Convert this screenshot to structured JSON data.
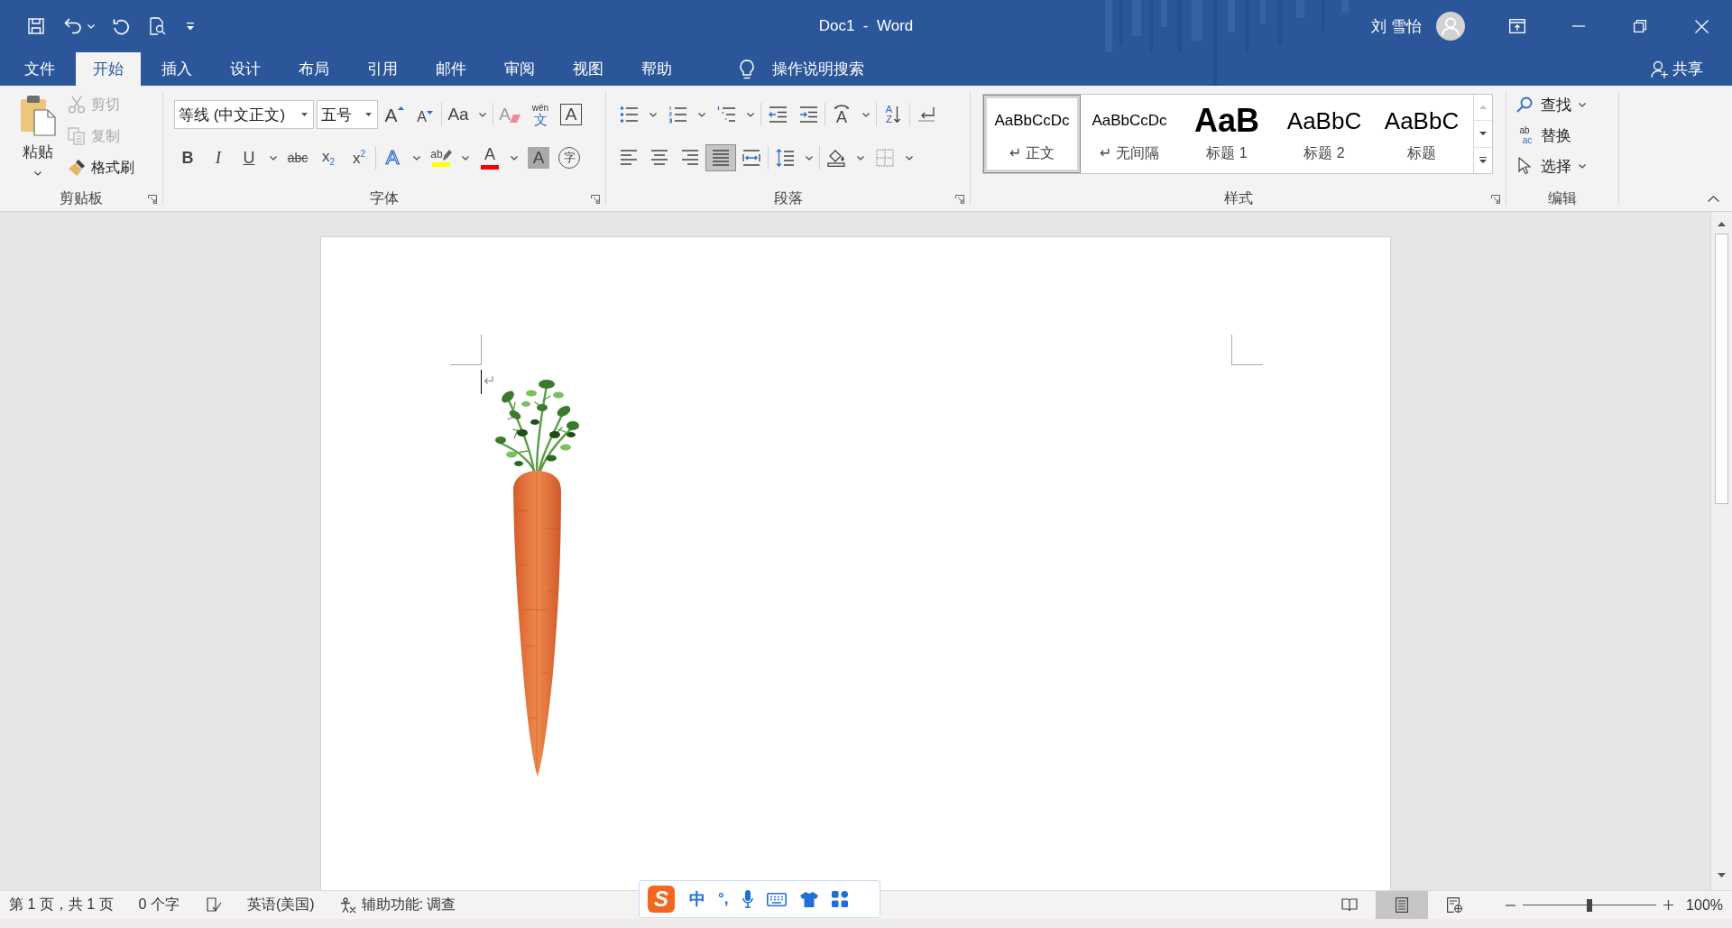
{
  "window": {
    "title": "Doc1  -  Word",
    "user": "刘 雪怡"
  },
  "tabs": [
    {
      "label": "文件",
      "selected": false
    },
    {
      "label": "开始",
      "selected": true
    },
    {
      "label": "插入",
      "selected": false
    },
    {
      "label": "设计",
      "selected": false
    },
    {
      "label": "布局",
      "selected": false
    },
    {
      "label": "引用",
      "selected": false
    },
    {
      "label": "邮件",
      "selected": false
    },
    {
      "label": "审阅",
      "selected": false
    },
    {
      "label": "视图",
      "selected": false
    },
    {
      "label": "帮助",
      "selected": false
    }
  ],
  "tell_me": {
    "placeholder": "操作说明搜索"
  },
  "share": {
    "label": "共享"
  },
  "clipboard": {
    "paste": "粘贴",
    "commands": [
      {
        "kind": "cut",
        "label": "剪切",
        "disabled": true
      },
      {
        "kind": "copy",
        "label": "复制",
        "disabled": true
      },
      {
        "kind": "format_painter",
        "label": "格式刷",
        "disabled": false
      }
    ],
    "group_label": "剪贴板",
    "launcher": true
  },
  "font": {
    "font_name": "等线 (中文正文)",
    "font_size": "五号",
    "row_1": [
      [
        {
          "kind": "grow",
          "glyph": "A",
          "dropdown": false
        },
        {
          "kind": "shrink",
          "glyph": "A",
          "dropdown": false
        }
      ],
      [
        {
          "kind": "case",
          "glyph": "Aa",
          "dropdown": true
        }
      ],
      [
        {
          "kind": "clear",
          "glyph": "A",
          "dropdown": false
        },
        {
          "kind": "phonetic",
          "annotation": "wén",
          "glyph": "文",
          "dropdown": false
        },
        {
          "kind": "border",
          "glyph": "A",
          "dropdown": false
        }
      ]
    ],
    "row_2": [
      [
        {
          "kind": "bold",
          "glyph": "B",
          "dropdown": false
        },
        {
          "kind": "italic",
          "glyph": "I",
          "dropdown": false
        },
        {
          "kind": "underline",
          "glyph": "U",
          "dropdown": true
        },
        {
          "kind": "strike",
          "glyph": "abc",
          "dropdown": false
        },
        {
          "kind": "subscript",
          "glyph": "x$_{2}$",
          "dropdown": false
        },
        {
          "kind": "superscript",
          "glyph": "x$^{2}$",
          "dropdown": false
        }
      ],
      [
        {
          "kind": "effects",
          "glyph": "A",
          "dropdown": true
        },
        {
          "kind": "highlight",
          "glyph": "ab",
          "color": "#ffff00",
          "dropdown": true
        },
        {
          "kind": "font_color",
          "glyph": "A",
          "color": "#ff0000",
          "dropdown": true
        },
        {
          "kind": "shading",
          "glyph": "A",
          "dropdown": false
        },
        {
          "kind": "enclose",
          "glyph": "字",
          "dropdown": false
        }
      ]
    ],
    "group_label": "字体",
    "launcher": true
  },
  "paragraph": {
    "row_1": [
      [
        {
          "kind": "bullets",
          "dropdown": true,
          "selected": false
        },
        {
          "kind": "numbering",
          "dropdown": true,
          "selected": false
        },
        {
          "kind": "multilevel",
          "dropdown": true,
          "selected": false
        }
      ],
      [
        {
          "kind": "decrease_indent",
          "dropdown": false,
          "selected": false
        },
        {
          "kind": "increase_indent",
          "dropdown": false,
          "selected": false
        }
      ],
      [
        {
          "kind": "layout",
          "glyph": "A",
          "dropdown": true,
          "selected": false
        }
      ],
      [
        {
          "kind": "sort",
          "glyph": "A",
          "glyph_2": "Z",
          "dropdown": false,
          "selected": false
        }
      ],
      [
        {
          "kind": "show_marks",
          "dropdown": false,
          "selected": false
        }
      ]
    ],
    "row_2": [
      [
        {
          "kind": "left",
          "dropdown": false,
          "selected": false
        },
        {
          "kind": "center",
          "dropdown": false,
          "selected": false
        },
        {
          "kind": "right",
          "dropdown": false,
          "selected": false
        },
        {
          "kind": "justify",
          "dropdown": false,
          "selected": true
        },
        {
          "kind": "distributed",
          "dropdown": false,
          "selected": false
        }
      ],
      [
        {
          "kind": "line_spacing",
          "dropdown": true,
          "selected": false
        }
      ],
      [
        {
          "kind": "para_shading",
          "dropdown": true,
          "selected": false
        },
        {
          "kind": "borders",
          "dropdown": true,
          "selected": false
        }
      ]
    ],
    "group_label": "段落",
    "launcher": true
  },
  "styles": {
    "items": [
      {
        "kind": "normal",
        "preview": "AaBbCcDc",
        "name": "↵ 正文",
        "selected": true
      },
      {
        "kind": "no_spacing",
        "preview": "AaBbCcDc",
        "name": "↵ 无间隔",
        "selected": false
      },
      {
        "kind": "heading_1",
        "preview": "AaB",
        "name": "标题 1",
        "selected": false
      },
      {
        "kind": "heading_2",
        "preview": "AaBbC",
        "name": "标题 2",
        "selected": false
      },
      {
        "kind": "title",
        "preview": "AaBbC",
        "name": "标题",
        "selected": false
      }
    ],
    "group_label": "样式",
    "launcher": true
  },
  "editing": {
    "items": [
      {
        "kind": "find",
        "label": "查找",
        "dropdown": true
      },
      {
        "kind": "replace",
        "label": "替换",
        "glyph": "ab",
        "glyph_2": "ac",
        "dropdown": false
      },
      {
        "kind": "select",
        "label": "选择",
        "dropdown": true
      }
    ],
    "group_label": "编辑",
    "launcher": false
  },
  "status_bar": {
    "page": "第 1 页，共 1 页",
    "words": "0 个字",
    "language": "英语(美国)",
    "accessibility": "辅助功能: 调查",
    "views": [
      {
        "kind": "read",
        "selected": false
      },
      {
        "kind": "print",
        "selected": true
      },
      {
        "kind": "web",
        "selected": false
      }
    ],
    "zoom": {
      "level": 0.5,
      "reading": "100%"
    }
  },
  "ime_toolbar": {
    "logo": "S",
    "mode": "中",
    "punctuation": "°,"
  }
}
